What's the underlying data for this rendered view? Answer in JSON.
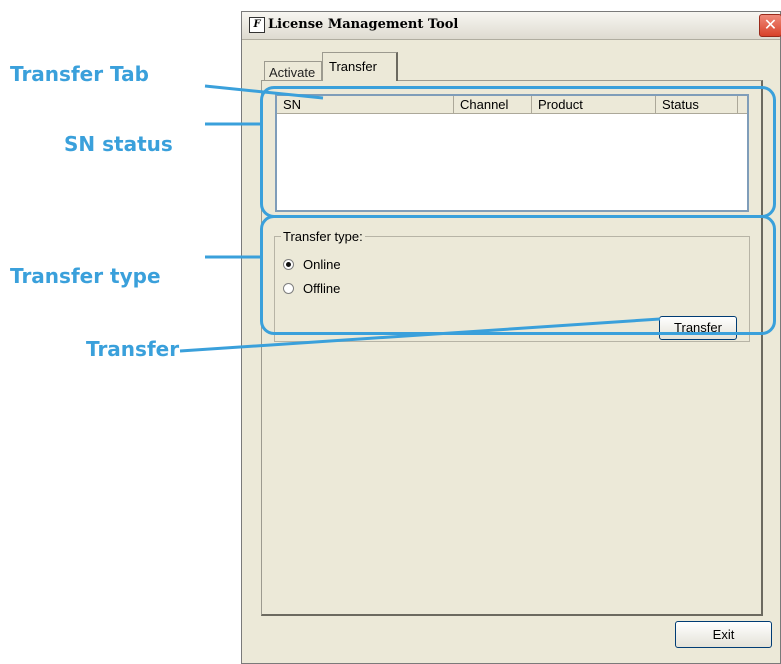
{
  "annotations": {
    "transfer_tab": "Transfer Tab",
    "sn_status": "SN status",
    "transfer_type": "Transfer type",
    "transfer": "Transfer"
  },
  "window": {
    "title": "License Management Tool",
    "close_icon": "close-icon",
    "app_icon": "license-app-icon"
  },
  "tabs": [
    {
      "label": "Activate",
      "active": false
    },
    {
      "label": "Transfer",
      "active": true
    }
  ],
  "list": {
    "columns": [
      "SN",
      "Channel",
      "Product",
      "Status"
    ],
    "rows": []
  },
  "transfer_type": {
    "legend": "Transfer type:",
    "options": [
      {
        "label": "Online",
        "checked": true
      },
      {
        "label": "Offline",
        "checked": false
      }
    ]
  },
  "buttons": {
    "transfer": "Transfer",
    "exit": "Exit"
  },
  "colors": {
    "annotation": "#3aa0db",
    "window_bg": "#ece9d8",
    "close_button": "#d8422a"
  }
}
